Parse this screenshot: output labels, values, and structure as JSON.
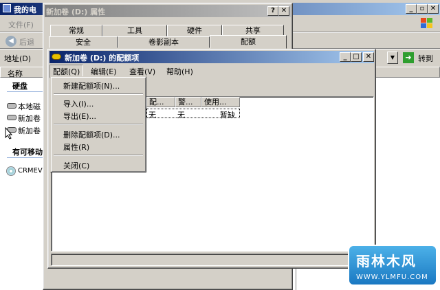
{
  "explorer": {
    "title": "我的电",
    "menu_file": "文件(F)",
    "back": "后退",
    "address_label": "地址(D)",
    "go": "转到",
    "col_name": "名称",
    "section_hdd": "硬盘",
    "drive_local": "本地磁",
    "drive_new1": "新加卷",
    "drive_new2": "新加卷",
    "section_removable": "有可移动",
    "drive_cd": "CRMEVO"
  },
  "props": {
    "title": "新加卷 (D:) 属性",
    "tabs_row1": [
      "常规",
      "工具",
      "硬件",
      "共享"
    ],
    "tabs_row2": [
      "安全",
      "卷影副本",
      "配额"
    ]
  },
  "quota": {
    "title": "新加卷 (D:) 的配额项",
    "menus": [
      "配额(Q)",
      "编辑(E)",
      "查看(V)",
      "帮助(H)"
    ],
    "columns": [
      "配...",
      "警...",
      "使用..."
    ],
    "row": {
      "limit": "无",
      "warn": "无",
      "used": "暂缺"
    }
  },
  "dropdown": {
    "items": [
      "新建配额项(N)...",
      "导入(I)...",
      "导出(E)...",
      "删除配额项(D)...",
      "属性(R)",
      "关闭(C)"
    ]
  },
  "watermark": {
    "brand": "雨林木风",
    "url": "WWW.YLMFU.COM"
  },
  "colors": {
    "title_active": "#0a246a",
    "face": "#d4d0c8",
    "go_green": "#2e9e2e"
  }
}
